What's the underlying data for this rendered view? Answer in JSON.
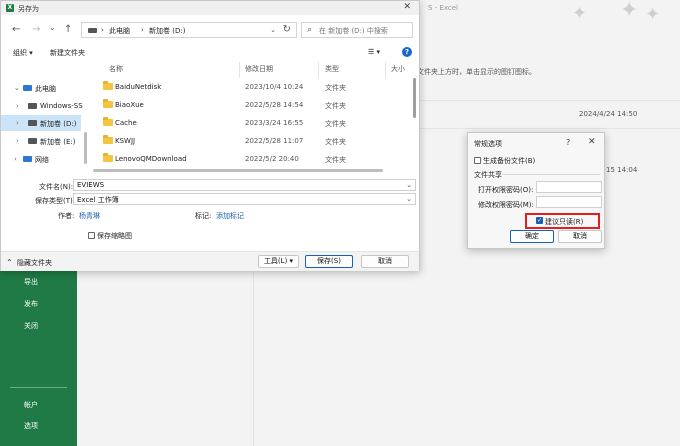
{
  "background": {
    "title_fragment": "S - Excel",
    "hint_text": "文件夹上方时，单击显示的图钉图标。",
    "date_1": "2024/4/24 14:50",
    "date_2": "15 14:04",
    "sidebar": [
      {
        "id": "export",
        "label": "导出"
      },
      {
        "id": "publish",
        "label": "发布"
      },
      {
        "id": "close",
        "label": "关闭"
      },
      {
        "id": "account",
        "label": "帐户"
      },
      {
        "id": "options",
        "label": "选项"
      }
    ]
  },
  "save_dialog": {
    "title": "另存为",
    "close_glyph": "✕",
    "nav": {
      "back": "←",
      "forward": "→",
      "dropdown": "⌄",
      "up": "↑"
    },
    "address": {
      "sep": "›",
      "pc": "此电脑",
      "drive": "新加卷 (D:)",
      "dropdown": "⌄",
      "refresh": "↻"
    },
    "search": {
      "icon": "⌕",
      "placeholder": "在 新加卷 (D:) 中搜索"
    },
    "toolbar": {
      "organize": "组织 ▾",
      "new_folder": "新建文件夹",
      "view": "☰ ▾",
      "help": "?"
    },
    "tree": [
      {
        "label": "此电脑",
        "chevron": "⌄",
        "color": "#2b79d1"
      },
      {
        "label": "Windows-SSD",
        "chevron": "›",
        "color": "#555555"
      },
      {
        "label": "新加卷 (D:)",
        "chevron": "›",
        "color": "#555555",
        "selected": true
      },
      {
        "label": "新加卷 (E:)",
        "chevron": "›",
        "color": "#555555"
      },
      {
        "label": "网络",
        "chevron": "›",
        "color": "#2b79d1"
      }
    ],
    "columns": {
      "name": "名称",
      "date": "修改日期",
      "type": "类型",
      "size": "大小"
    },
    "files": [
      {
        "name": "BaiduNetdisk",
        "date": "2023/10/4 10:24",
        "type": "文件夹"
      },
      {
        "name": "BiaoXue",
        "date": "2022/5/28 14:54",
        "type": "文件夹"
      },
      {
        "name": "Cache",
        "date": "2023/3/24 16:55",
        "type": "文件夹"
      },
      {
        "name": "KSWJJ",
        "date": "2022/5/28 11:07",
        "type": "文件夹"
      },
      {
        "name": "LenovoQMDownload",
        "date": "2022/5/2 20:40",
        "type": "文件夹"
      }
    ],
    "filename_label": "文件名(N):",
    "filename_value": "EVIEWS",
    "filetype_label": "保存类型(T):",
    "filetype_value": "Excel 工作簿",
    "author_label": "作者:",
    "author_value": "杨青琳",
    "tags_label": "标记:",
    "tags_value": "添加标记",
    "thumbnail_label": "保存缩略图",
    "hide_folders": "隐藏文件夹",
    "tools": "工具(L) ▾",
    "save": "保存(S)",
    "cancel": "取消"
  },
  "general_dialog": {
    "title": "常规选项",
    "help": "?",
    "close": "✕",
    "backup_label": "生成备份文件(B)",
    "group": "文件共享",
    "open_pwd_label": "打开权限密码(O):",
    "modify_pwd_label": "修改权限密码(M):",
    "readonly_label": "建议只读(R)",
    "readonly_checked": true,
    "highlight_color": "#e02020",
    "ok": "确定",
    "cancel": "取消"
  }
}
